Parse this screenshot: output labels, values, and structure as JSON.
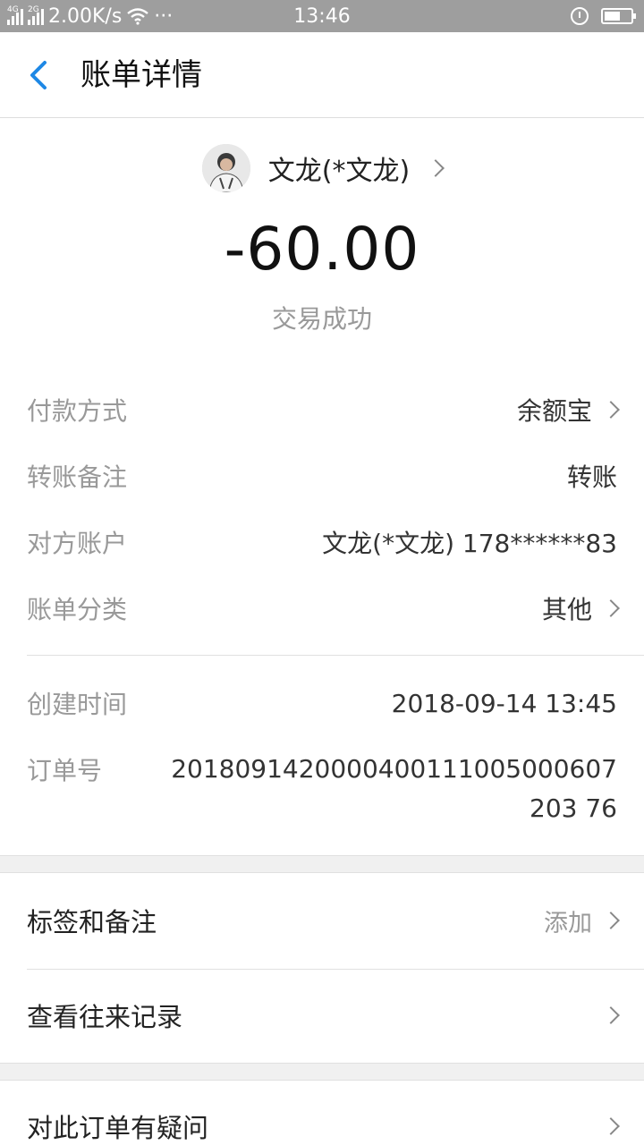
{
  "status_bar": {
    "network_1": "4G",
    "network_2": "2G",
    "speed": "2.00K/s",
    "dots": "···",
    "time": "13:46"
  },
  "nav": {
    "title": "账单详情"
  },
  "header": {
    "payee_name": "文龙(*文龙)",
    "amount": "-60.00",
    "status": "交易成功"
  },
  "details": [
    {
      "label": "付款方式",
      "value": "余额宝",
      "has_arrow": true
    },
    {
      "label": "转账备注",
      "value": "转账",
      "has_arrow": false
    },
    {
      "label": "对方账户",
      "value": "文龙(*文龙) 178******83",
      "has_arrow": false
    },
    {
      "label": "账单分类",
      "value": "其他",
      "has_arrow": true
    }
  ],
  "meta": {
    "create_time_label": "创建时间",
    "create_time": "2018-09-14 13:45",
    "order_label": "订单号",
    "order_no": "2018091420000400111005000607203 76"
  },
  "actions": {
    "tags_label": "标签和备注",
    "tags_hint": "添加",
    "history_label": "查看往来记录",
    "question_label": "对此订单有疑问"
  },
  "colors": {
    "accent": "#1e88e5",
    "status_bar": "#9e9e9e",
    "separator": "#f0f0f0"
  },
  "icons": [
    "back-arrow-icon",
    "chevron-right-icon",
    "alarm-icon",
    "battery-icon",
    "wifi-icon",
    "signal-icon"
  ]
}
